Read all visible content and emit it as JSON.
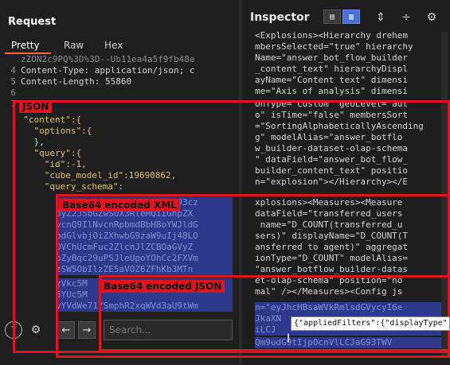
{
  "left": {
    "title": "Request",
    "tabs": [
      "Pretty",
      "Raw",
      "Hex"
    ],
    "lines": [
      {
        "n": "",
        "t": "zZON2c9PQ%3D%3D--Ub11ea4a5f9fb48e"
      },
      {
        "n": "4",
        "t": "Content-Type: application/json; c"
      },
      {
        "n": "5",
        "t": "Content-Length: 55860"
      },
      {
        "n": "6",
        "t": ""
      },
      {
        "n": "7",
        "t": "{"
      },
      {
        "n": "",
        "t": "  \"content\":{"
      },
      {
        "n": "",
        "t": "    \"options\":{"
      },
      {
        "n": "",
        "t": "    },"
      },
      {
        "n": "",
        "t": "    \"query\":{"
      },
      {
        "n": "",
        "t": "      \"id\":-1,"
      },
      {
        "n": "",
        "t": "      \"cube_model_id\":19690862,"
      },
      {
        "n": "",
        "t": "      \"query_schema\":"
      }
    ],
    "b64_lines": [
      "                  ZwvUm93cz",
      "byZ2J5bGZwSUX3RleHQiIGhpZX",
      "vcnQ9IlNvcnRpbmdBbHBoYWJldG",
      "pdGlvbjOiZXhwbG9zaW9uIj48LO",
      "OVChUcmFuc2ZlcnJlZCBOaGVyZ",
      "pZyBqc29uPSJleUpoYOhCc2FXVm",
      "zSW5ObIlzZE5aVOZ6ZFhKb3MTn",
      "zVkc5M                     ",
      "6YUc5M",
      "yYVdWe71YSmphR2xqWVd3aU9tWm"
    ],
    "search_placeholder": "Search..."
  },
  "labels": {
    "json": "JSON",
    "xml": "Base64 encoded XML",
    "b64json": "Base64 encoded JSON"
  },
  "right": {
    "title": "Inspector",
    "lines": [
      "<Explosions><Hierarchy drehem",
      "mbersSelected=\"true\" hierarchy",
      "Name=\"answer_bot_flow_builder",
      "_content_text\" hierarchyDispl",
      "ayName=\"Content text\" dimensi",
      "me=\"Axis of analysis\" dimensi",
      "onType=\"custom\" geoLevel=\"aut",
      "o\" isTime=\"false\" membersSort",
      "=\"SortingAlphabeticallyAscending",
      "g\" modelAlias=\"answer_botflo",
      "w_builder-dataset-olap-schema",
      "\" dataField=\"answer_bot_flow_",
      "builder_content_text\" positio",
      "n=\"explosion\"></Hierarchy></E",
      "xplosions><Measures><Measure ",
      "dataField=\"transferred_users",
      " name=\"D_COUNT(transferred_u",
      "sers)\" displayName=\"D_COUNT(T",
      "ansferred to agent)\" aggregat",
      "ionType=\"D_COUNT\" modelAlias=",
      "\"answer_botflow_builder-datas",
      "et-olap-schema\" position=\"no",
      "mal\" /></Measures><Config js",
      "n=\"eyJhcHBsaWVkRmlsdGVycyI6e",
      "JkaXN",
      "iLCJ",
      "Qm9udG9tIjpOcnVlLCJaG93TWV"
    ]
  },
  "popup_text": "{\"appliedFilters\":{\"displayType\":\"cor"
}
